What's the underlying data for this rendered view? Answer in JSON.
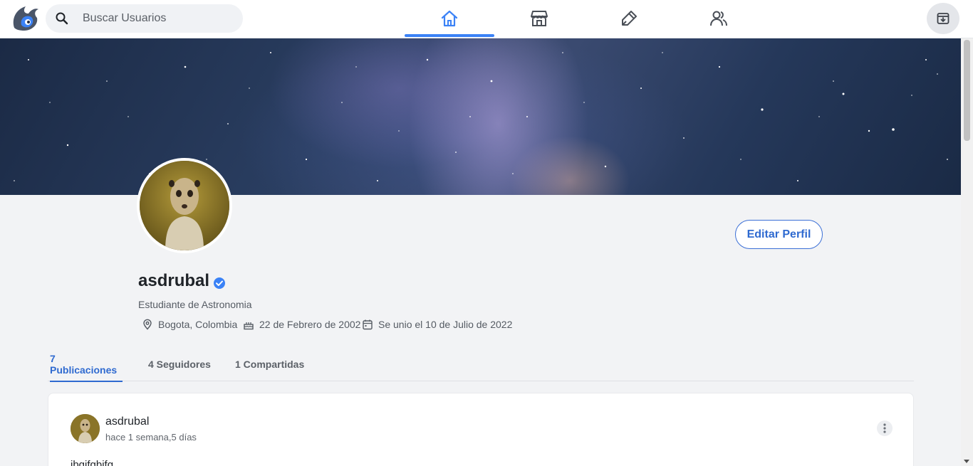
{
  "nav": {
    "search_placeholder": "Buscar Usuarios",
    "tabs": [
      {
        "name": "home-icon",
        "active": true
      },
      {
        "name": "store-icon",
        "active": false
      },
      {
        "name": "pen-icon",
        "active": false
      },
      {
        "name": "users-icon",
        "active": false
      }
    ],
    "right_icon": "archive-icon",
    "accent_color": "#3b82f6"
  },
  "profile": {
    "username": "asdrubal",
    "verified": true,
    "bio": "Estudiante de Astronomia",
    "location": "Bogota, Colombia",
    "birthday": "22 de Febrero de 2002",
    "joined": "Se unio el 10 de Julio de 2022",
    "edit_label": "Editar Perfil"
  },
  "tabs": [
    {
      "label": "7 Publicaciones",
      "active": true
    },
    {
      "label": "4 Seguidores",
      "active": false
    },
    {
      "label": "1 Compartidas",
      "active": false
    }
  ],
  "post": {
    "author": "asdrubal",
    "time": "hace 1 semana,5 días",
    "text": "ibgifgbifg"
  }
}
